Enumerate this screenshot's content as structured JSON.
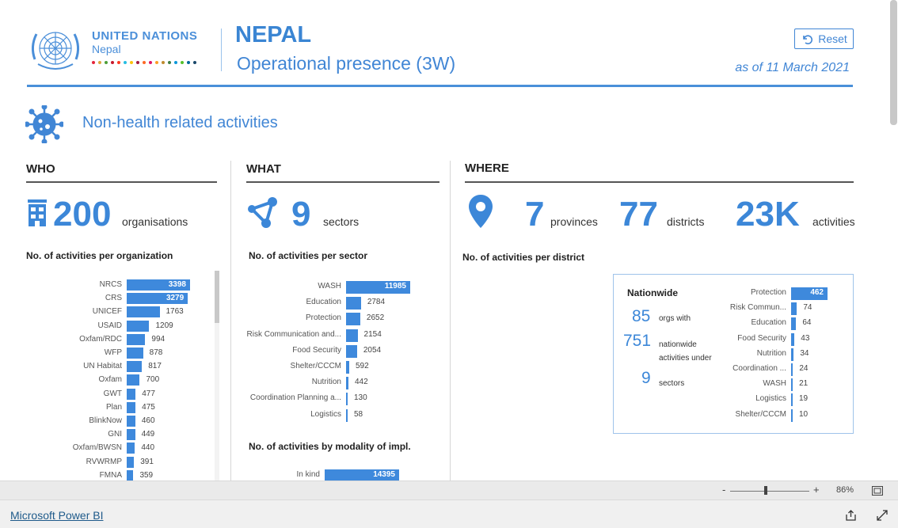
{
  "header": {
    "org_name": "UNITED NATIONS",
    "org_country": "Nepal",
    "sdg_colors": [
      "#e5243b",
      "#dda63a",
      "#4c9f38",
      "#c5192d",
      "#ff3a21",
      "#26bde2",
      "#fcc30b",
      "#a21942",
      "#fd6925",
      "#dd1367",
      "#fd9d24",
      "#bf8b2e",
      "#3f7e44",
      "#0a97d9",
      "#56c02b",
      "#00689d",
      "#19486a"
    ],
    "title": "NEPAL",
    "subtitle": "Operational presence (3W)",
    "reset_label": "Reset",
    "as_of": "as of 11 March 2021"
  },
  "section": {
    "title": "Non-health related activities",
    "icon": "virus-icon"
  },
  "who": {
    "heading": "WHO",
    "count": "200",
    "unit": "organisations",
    "chart_title": "No. of activities per organization",
    "chart_data": {
      "type": "bar",
      "orientation": "horizontal",
      "categories": [
        "NRCS",
        "CRS",
        "UNICEF",
        "USAID",
        "Oxfam/RDC",
        "WFP",
        "UN Habitat",
        "Oxfam",
        "GWT",
        "Plan",
        "BlinkNow",
        "GNI",
        "Oxfam/BWSN",
        "RVWRMP",
        "FMNA"
      ],
      "values": [
        3398,
        3279,
        1763,
        1209,
        994,
        878,
        817,
        700,
        477,
        475,
        460,
        449,
        440,
        391,
        359
      ],
      "labels": [
        "3398",
        "3279",
        "1763",
        "1209",
        "994",
        "878",
        "817",
        "700",
        "477",
        "475",
        "460",
        "449",
        "440",
        "391",
        "359"
      ]
    }
  },
  "what": {
    "heading": "WHAT",
    "count": "9",
    "unit": "sectors",
    "chart_title": "No. of activities per sector",
    "chart_data": {
      "type": "bar",
      "orientation": "horizontal",
      "categories": [
        "WASH",
        "Education",
        "Protection",
        "Risk Communication and...",
        "Food Security",
        "Shelter/CCCM",
        "Nutrition",
        "Coordination Planning a...",
        "Logistics"
      ],
      "values": [
        11985,
        2784,
        2652,
        2154,
        2054,
        592,
        442,
        130,
        58
      ],
      "labels": [
        "11985",
        "2784",
        "2652",
        "2154",
        "2054",
        "592",
        "442",
        "130",
        "58"
      ]
    },
    "modality_title": "No. of activities by modality of impl.",
    "modality_data": {
      "type": "bar",
      "orientation": "horizontal",
      "categories": [
        "In kind"
      ],
      "values": [
        14395
      ],
      "labels": [
        "14395"
      ]
    }
  },
  "where": {
    "heading": "WHERE",
    "provinces": "7",
    "provinces_unit": "provinces",
    "districts": "77",
    "districts_unit": "districts",
    "activities": "23K",
    "activities_unit": "activities",
    "chart_title": "No. of activities per district"
  },
  "nationwide": {
    "title": "Nationwide",
    "orgs": "85",
    "orgs_text": "orgs with",
    "activities": "751",
    "activities_text_1": "nationwide",
    "activities_text_2": "activities under",
    "sectors": "9",
    "sectors_text": "sectors",
    "chart_data": {
      "type": "bar",
      "orientation": "horizontal",
      "categories": [
        "Protection",
        "Risk Commun...",
        "Education",
        "Food Security",
        "Nutrition",
        "Coordination ...",
        "WASH",
        "Logistics",
        "Shelter/CCCM"
      ],
      "values": [
        462,
        74,
        64,
        43,
        34,
        24,
        21,
        19,
        10
      ],
      "labels": [
        "462",
        "74",
        "64",
        "43",
        "34",
        "24",
        "21",
        "19",
        "10"
      ]
    }
  },
  "zoom": {
    "minus": "-",
    "plus": "+",
    "level": "86%",
    "slider_fraction": 0.43
  },
  "footer": {
    "link": "Microsoft Power BI"
  }
}
